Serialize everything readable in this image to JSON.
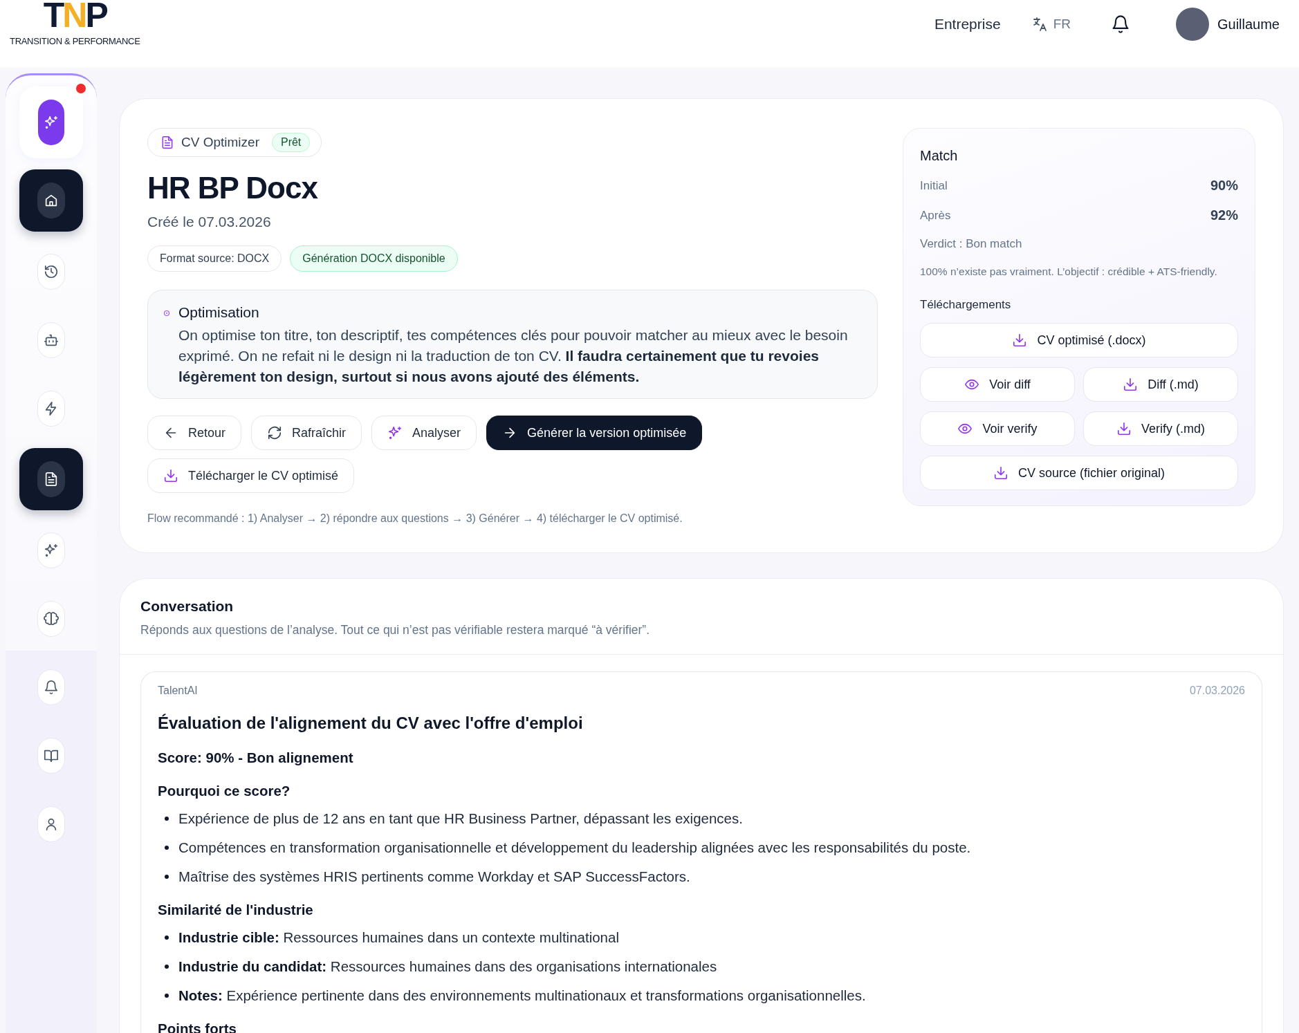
{
  "header": {
    "logo": {
      "mark": "TNP",
      "tagline": "TRANSITION & PERFORMANCE"
    },
    "nav_link": "Entreprise",
    "language": "FR",
    "user": {
      "name": "Guillaume"
    }
  },
  "sidebar": {
    "items": [
      {
        "kind": "featured",
        "selected": false,
        "notification": true
      },
      {
        "kind": "nav",
        "selected": true
      },
      {
        "kind": "nav",
        "selected": false
      },
      {
        "kind": "nav",
        "selected": false
      },
      {
        "kind": "nav",
        "selected": false
      },
      {
        "kind": "nav",
        "selected": true
      },
      {
        "kind": "nav",
        "selected": false
      },
      {
        "kind": "nav",
        "selected": false
      },
      {
        "kind": "nav",
        "selected": false
      },
      {
        "kind": "nav",
        "selected": false
      },
      {
        "kind": "nav",
        "selected": false
      }
    ]
  },
  "document": {
    "tool_chip": {
      "label": "CV Optimizer",
      "status": "Prêt"
    },
    "title": "HR BP Docx",
    "created": "Créé le 07.03.2026",
    "tags": [
      {
        "label": "Format source: DOCX",
        "kind": "neutral"
      },
      {
        "label": "Génération DOCX disponible",
        "kind": "success"
      }
    ],
    "notice": {
      "title": "Optimisation",
      "text": "On optimise ton titre, ton descriptif, tes compétences clés pour pouvoir matcher au mieux avec le besoin exprimé. On ne refait ni le design ni la traduction de ton CV. **Il faudra certainement que tu revoies légèrement ton design, surtout si nous avons ajouté des éléments.**"
    },
    "actions": [
      {
        "label": "Retour",
        "kind": "secondary"
      },
      {
        "label": "Rafraîchir",
        "kind": "secondary"
      },
      {
        "label": "Analyser",
        "kind": "secondary"
      },
      {
        "label": "Générer la version optimisée",
        "kind": "primary"
      },
      {
        "label": "Télécharger le CV optimisé",
        "kind": "secondary"
      }
    ],
    "flow_hint": "Flow recommandé : 1) Analyser → 2) répondre aux questions → 3) Générer → 4) télécharger le CV optimisé."
  },
  "match": {
    "title": "Match",
    "scores": [
      {
        "label": "Initial",
        "value": "90%"
      },
      {
        "label": "Après",
        "value": "92%"
      }
    ],
    "verdict": "Verdict : Bon match",
    "note": "100% n’existe pas vraiment. L’objectif : crédible + ATS-friendly.",
    "downloads_title": "Téléchargements",
    "downloads": [
      {
        "label": "CV optimisé (.docx)",
        "kind": "download-wide"
      },
      {
        "label": "Voir diff",
        "kind": "view"
      },
      {
        "label": "Diff (.md)",
        "kind": "download"
      },
      {
        "label": "Voir verify",
        "kind": "view"
      },
      {
        "label": "Verify (.md)",
        "kind": "download"
      },
      {
        "label": "CV source (fichier original)",
        "kind": "download-wide"
      }
    ]
  },
  "conversation": {
    "title": "Conversation",
    "subtitle": "Réponds aux questions de l’analyse. Tout ce qui n’est pas vérifiable restera marqué “à vérifier”.",
    "messages": [
      {
        "author": "TalentAI",
        "date": "07.03.2026",
        "blocks": [
          {
            "kind": "h1",
            "text": "Évaluation de l'alignement du CV avec l'offre d'emploi"
          },
          {
            "kind": "h2",
            "text": "Score: 90% - Bon alignement"
          },
          {
            "kind": "h3",
            "text": "Pourquoi ce score?"
          },
          {
            "kind": "list",
            "items": [
              "Expérience de plus de 12 ans en tant que HR Business Partner, dépassant les exigences.",
              "Compétences en transformation organisationnelle et développement du leadership alignées avec les responsabilités du poste.",
              "Maîtrise des systèmes HRIS pertinents comme Workday et SAP SuccessFactors."
            ]
          },
          {
            "kind": "h3",
            "text": "Similarité de l'industrie"
          },
          {
            "kind": "list",
            "items": [
              "**Industrie cible:** Ressources humaines dans un contexte multinational",
              "**Industrie du candidat:** Ressources humaines dans des organisations internationales",
              "**Notes:** Expérience pertinente dans des environnements multinationaux et transformations organisationnelles."
            ]
          },
          {
            "kind": "h3",
            "text": "Points forts"
          }
        ]
      }
    ]
  }
}
